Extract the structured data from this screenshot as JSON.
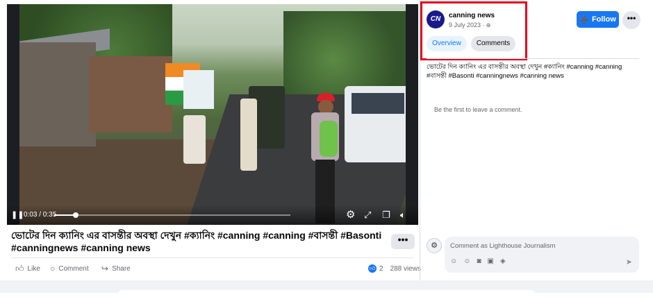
{
  "video": {
    "play_glyph": "❚❚",
    "time": "0:03 / 0:35",
    "progress_fraction": 0.09,
    "icons": {
      "settings": "gear-icon",
      "fullscreen": "expand-icon",
      "pip": "picture-in-picture-icon",
      "volume": "mute-icon"
    }
  },
  "post": {
    "title": "ভোটের দিন ক্যানিং এর বাসন্তীর অবস্থা দেখুন #ক্যানিং #canning #canning #বাসন্তী #Basonti #canningnews #canning news",
    "more_glyph": "•••",
    "actions": {
      "like": "Like",
      "comment": "Comment",
      "share": "Share"
    },
    "like_count": "2",
    "views": "288 views"
  },
  "sidebar": {
    "page_name": "canning news",
    "date": "9 July 2023 ·",
    "avatar_text": "CN",
    "tabs": {
      "overview": "Overview",
      "comments": "Comments"
    },
    "follow": "Follow",
    "more_glyph": "•••",
    "caption": "ভোটের দিন ক্যানিং এর বাসন্তীর অবস্থা দেখুন #ক্যানিং #canning #canning #বাসন্তী #Basonti #canningnews #canning news",
    "empty_comments": "Be the first to leave a comment.",
    "comment_placeholder": "Comment as Lighthouse Journalism"
  },
  "colors": {
    "accent": "#1877f2",
    "highlight_box": "#e3001b"
  }
}
